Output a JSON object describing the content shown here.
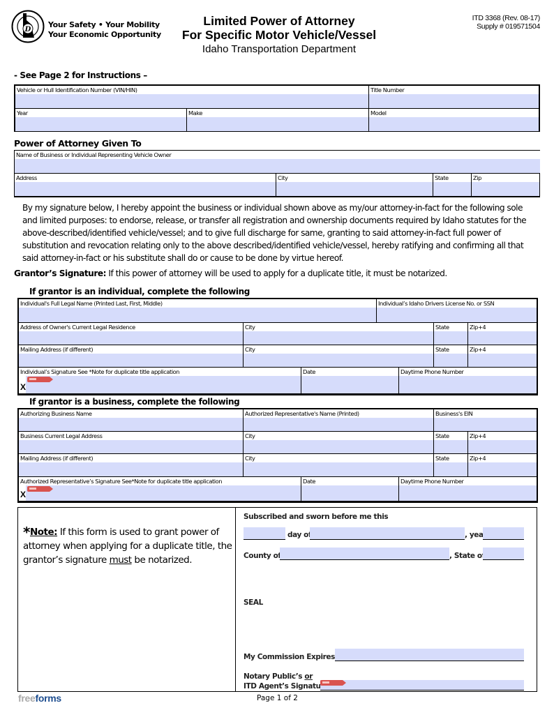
{
  "header": {
    "logo_icon": "idaho-transportation-department-seal-icon",
    "tagline_line1": "Your Safety  •  Your Mobility",
    "tagline_line2": "Your Economic Opportunity",
    "title_line1": "Limited Power of Attorney",
    "title_line2": "For Specific Motor Vehicle/Vessel",
    "subtitle": "Idaho Transportation Department",
    "form_number": "ITD 3368   (Rev. 08-17)",
    "supply_number": "Supply # 019571504"
  },
  "instructions_note": "- See Page 2 for Instructions –",
  "vehicle": {
    "vin_label": "Vehicle or Hull Identification Number (VIN/HIN)",
    "vin_value": "",
    "title_number_label": "Title Number",
    "title_number_value": "",
    "year_label": "Year",
    "year_value": "",
    "make_label": "Make",
    "make_value": "",
    "model_label": "Model",
    "model_value": ""
  },
  "attorney": {
    "heading": "Power of Attorney Given To",
    "name_label": "Name of Business or Individual Representing Vehicle Owner",
    "name_value": "",
    "address_label": "Address",
    "address_value": "",
    "city_label": "City",
    "city_value": "",
    "state_label": "State",
    "state_value": "",
    "zip_label": "Zip",
    "zip_value": ""
  },
  "authorization_text": "By my signature below, I hereby appoint the business or individual shown above as my/our attorney-in-fact for the following sole and limited purposes:  to endorse, release, or transfer all registration and ownership documents required by Idaho statutes for the above-described/identified vehicle/vessel; and to give full discharge for same, granting to said attorney-in-fact full power of substitution and revocation relating only to the above described/identified vehicle/vessel, hereby ratifying and confirming all that said attorney-in-fact or his substitute shall do or cause to be done by virtue hereof.",
  "grantor": {
    "label": "Grantor’s Signature:",
    "text": "  If this power of attorney will be used to apply for a duplicate title, it must be notarized."
  },
  "individual": {
    "heading": "If grantor is an individual, complete the following",
    "name_label": "Individual's Full Legal Name (Printed Last, First, Middle)",
    "license_label": "Individual’s Idaho Drivers License No. or SSN",
    "residence_label": "Address of Owner's Current Legal Residence",
    "city_label": "City",
    "state_label": "State",
    "zip_label": "Zip+4",
    "mailing_label": "Mailing Address (if different)",
    "mailing_city_label": "City",
    "mailing_state_label": "State",
    "mailing_zip_label": "Zip+4",
    "signature_label": "Individual’s Signature  See *Note for duplicate title application",
    "date_label": "Date",
    "phone_label": "Daytime Phone Number",
    "x_mark": "X"
  },
  "business": {
    "heading": "If grantor is a business, complete the following",
    "name_label": "Authorizing Business Name",
    "rep_name_label": "Authorized Representative's Name (Printed)",
    "ein_label": "Business's EIN",
    "address_label": "Business Current Legal Address",
    "city_label": "City",
    "state_label": "State",
    "zip_label": "Zip+4",
    "mailing_label": "Mailing Address (if different)",
    "mailing_city_label": "City",
    "mailing_state_label": "State",
    "mailing_zip_label": "Zip+4",
    "signature_label": "Authorized Representative’s Signature  See*Note for duplicate title application",
    "date_label": "Date",
    "phone_label": "Daytime Phone Number",
    "x_mark": "X"
  },
  "note": {
    "star": "*",
    "label": "Note:",
    "text_a": "  If this form is used to grant power of attorney when applying for a duplicate title, the grantor’s signature ",
    "must": "must",
    "text_b": " be notarized."
  },
  "notary": {
    "subscribed": "Subscribed and sworn before me this",
    "day_of": "day of",
    "year": ", year",
    "county_of": "County of",
    "state_of": ", State of",
    "seal": "SEAL",
    "commission": "My Commission Expires",
    "signature_line1": "Notary Public’s ",
    "signature_or": "or",
    "signature_line2": "ITD Agent’s Signature"
  },
  "footer": {
    "brand_free": "free",
    "brand_forms": "forms",
    "page": "Page 1 of 2"
  },
  "colors": {
    "field_fill": "#d6dcfb",
    "sign_here_tag": "#d9534f",
    "brand_blue": "#1d4d8f"
  }
}
